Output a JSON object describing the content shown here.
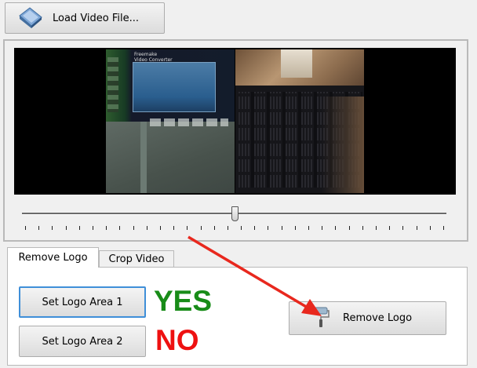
{
  "toolbar": {
    "load_label": "Load Video File..."
  },
  "tabs": [
    {
      "label": "Remove Logo",
      "active": true
    },
    {
      "label": "Crop Video",
      "active": false
    }
  ],
  "panel": {
    "set_logo_area_1": "Set Logo Area 1",
    "set_logo_area_2": "Set Logo Area 2",
    "remove_logo": "Remove Logo",
    "annotation_yes": "YES",
    "annotation_no": "NO"
  },
  "preview": {
    "screen_text_line1": "Freemake",
    "screen_text_line2": "Video Converter"
  },
  "slider": {
    "position_fraction": 0.5
  },
  "colors": {
    "yes": "#188c18",
    "no": "#ee1111",
    "arrow": "#e8281e",
    "focus": "#3f8fd8"
  },
  "icons": [
    "video-file-icon",
    "paint-roller-icon"
  ]
}
